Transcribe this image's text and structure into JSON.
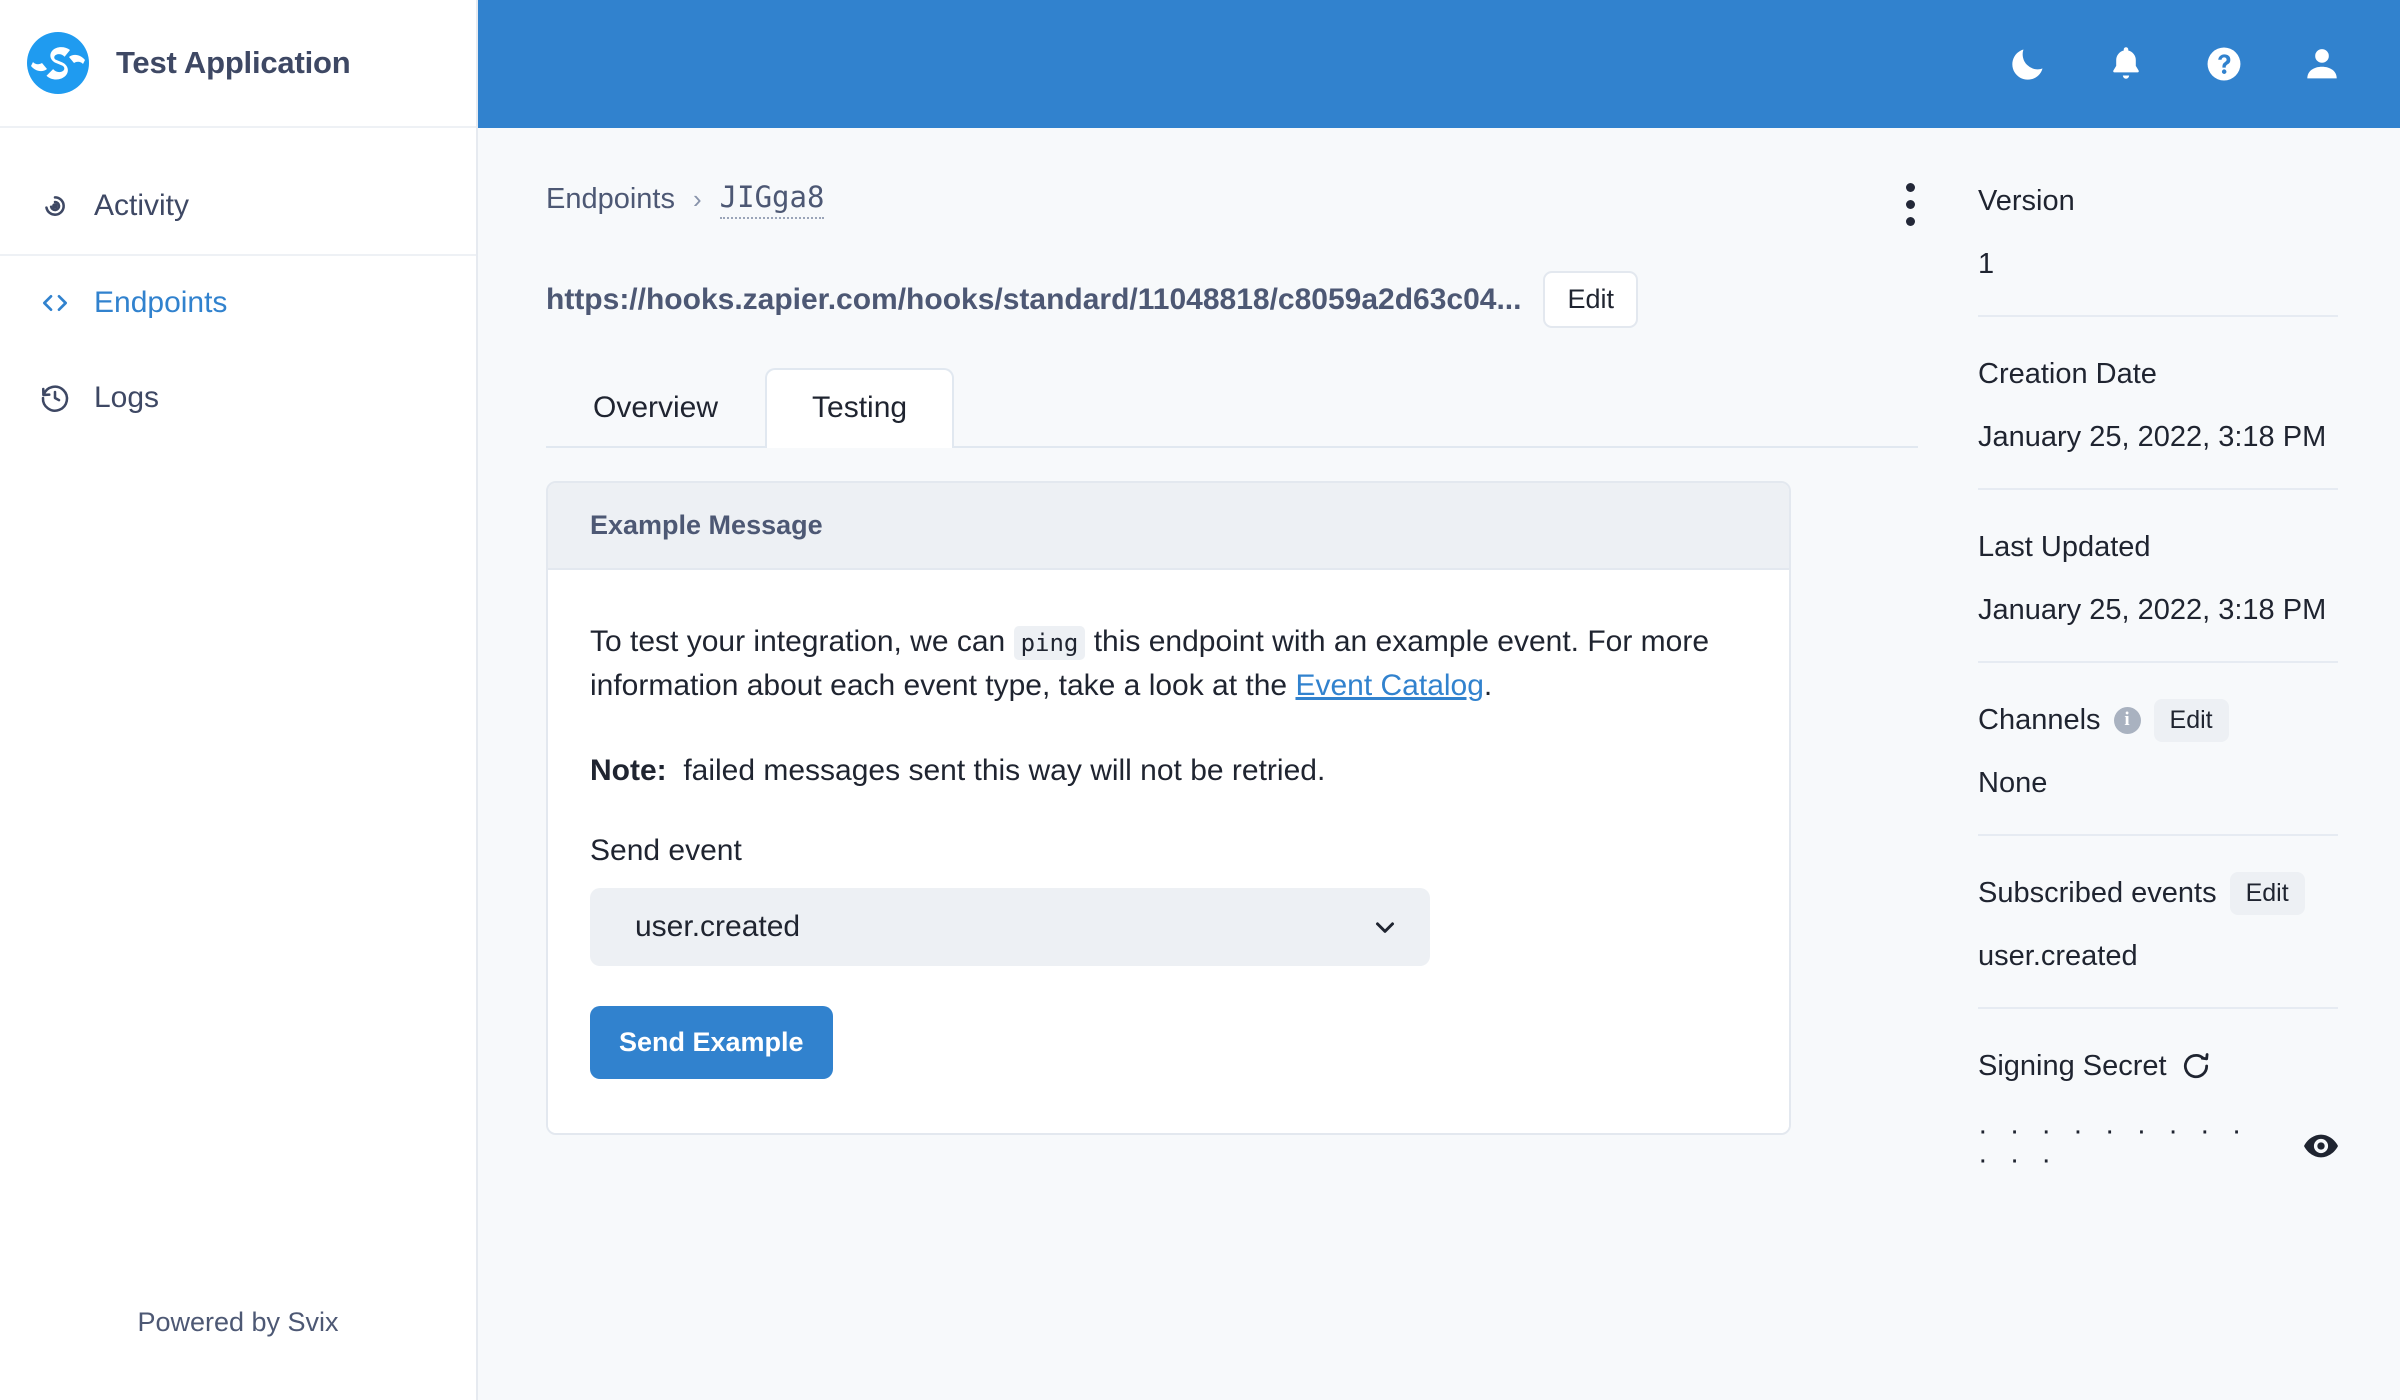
{
  "sidebar": {
    "brand": {
      "name": "Test Application",
      "logo_icon": "svix-logo-icon"
    },
    "items": [
      {
        "label": "Activity",
        "icon": "activity-target-icon",
        "active": false
      },
      {
        "label": "Endpoints",
        "icon": "code-brackets-icon",
        "active": true
      },
      {
        "label": "Logs",
        "icon": "history-clock-icon",
        "active": false
      }
    ],
    "footer": "Powered by Svix"
  },
  "topbar": {
    "icons": [
      {
        "name": "dark-mode-moon-icon"
      },
      {
        "name": "notifications-bell-icon"
      },
      {
        "name": "help-question-icon"
      },
      {
        "name": "user-account-icon"
      }
    ]
  },
  "breadcrumb": {
    "root": "Endpoints",
    "separator": "›",
    "current": "JIGga8"
  },
  "overflow_menu": {
    "name": "more-options-kebab"
  },
  "endpoint": {
    "url": "https://hooks.zapier.com/hooks/standard/11048818/c8059a2d63c04...",
    "edit_label": "Edit"
  },
  "tabs": [
    {
      "label": "Overview",
      "active": false
    },
    {
      "label": "Testing",
      "active": true
    }
  ],
  "card": {
    "title": "Example Message",
    "paragraph": {
      "part1": "To test your integration, we can ",
      "code": "ping",
      "part2": " this endpoint with an example event. For more information about each event type, take a look at the ",
      "link": "Event Catalog",
      "part3": "."
    },
    "note": {
      "label": "Note:",
      "text": "failed messages sent this way will not be retried."
    },
    "send_event": {
      "label": "Send event",
      "selected": "user.created",
      "options": [
        "user.created"
      ],
      "chevron_icon": "chevron-down-icon"
    },
    "submit_label": "Send Example"
  },
  "details": {
    "version": {
      "label": "Version",
      "value": "1"
    },
    "creation_date": {
      "label": "Creation Date",
      "value": "January 25, 2022, 3:18 PM"
    },
    "last_updated": {
      "label": "Last Updated",
      "value": "January 25, 2022, 3:18 PM"
    },
    "channels": {
      "label": "Channels",
      "info_icon": "info-icon",
      "edit_label": "Edit",
      "value": "None"
    },
    "subscribed_events": {
      "label": "Subscribed events",
      "edit_label": "Edit",
      "value": "user.created"
    },
    "signing_secret": {
      "label": "Signing Secret",
      "rotate_icon": "rotate-refresh-icon",
      "masked_value": "· · · · · · · · · · · ·",
      "reveal_icon": "eye-reveal-icon"
    }
  },
  "colors": {
    "brand_blue": "#3182ce",
    "page_bg": "#f7f9fb",
    "panel_bg": "#edf0f4",
    "text_dark": "#1f2430",
    "text_muted": "#4d5874"
  }
}
